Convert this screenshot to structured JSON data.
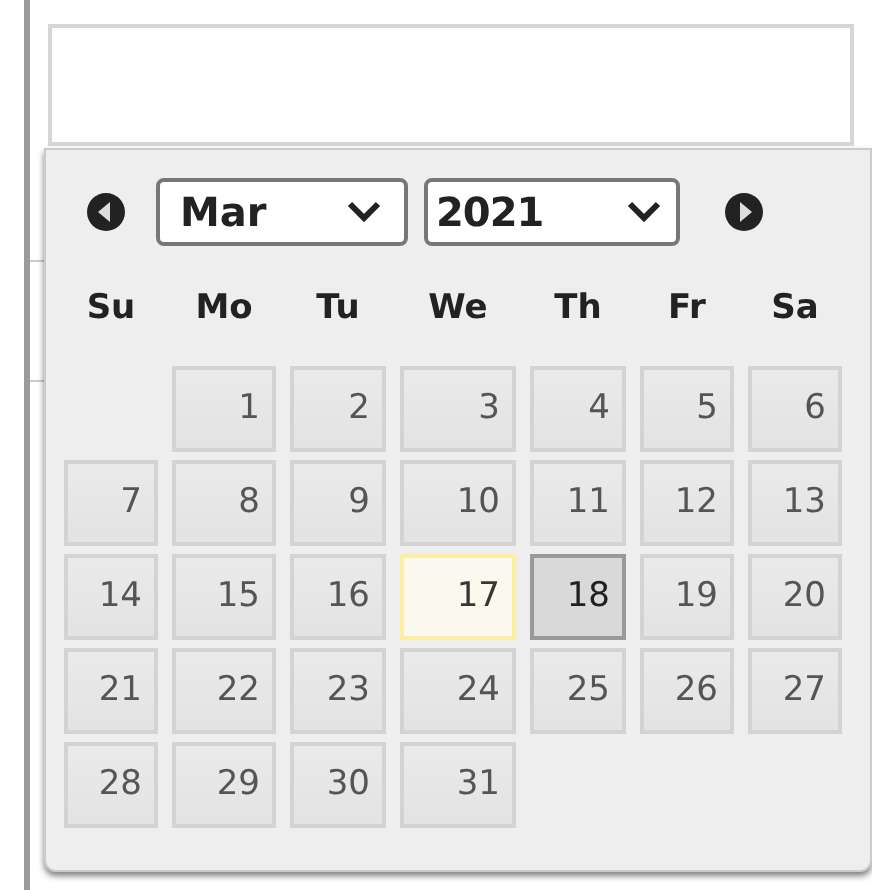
{
  "calendar": {
    "month": "Mar",
    "year": "2021",
    "weekdays": [
      "Su",
      "Mo",
      "Tu",
      "We",
      "Th",
      "Fr",
      "Sa"
    ],
    "weeks": [
      [
        {
          "day": "1",
          "today": false,
          "selected": false
        },
        {
          "day": "2",
          "today": false,
          "selected": false
        },
        {
          "day": "3",
          "today": false,
          "selected": false
        },
        {
          "day": "4",
          "today": false,
          "selected": false
        },
        {
          "day": "5",
          "today": false,
          "selected": false
        },
        {
          "day": "6",
          "today": false,
          "selected": false
        }
      ],
      [
        {
          "day": "7",
          "today": false,
          "selected": false
        },
        {
          "day": "8",
          "today": false,
          "selected": false
        },
        {
          "day": "9",
          "today": false,
          "selected": false
        },
        {
          "day": "10",
          "today": false,
          "selected": false
        },
        {
          "day": "11",
          "today": false,
          "selected": false
        },
        {
          "day": "12",
          "today": false,
          "selected": false
        },
        {
          "day": "13",
          "today": false,
          "selected": false
        }
      ],
      [
        {
          "day": "14",
          "today": false,
          "selected": false
        },
        {
          "day": "15",
          "today": false,
          "selected": false
        },
        {
          "day": "16",
          "today": false,
          "selected": false
        },
        {
          "day": "17",
          "today": true,
          "selected": false
        },
        {
          "day": "18",
          "today": false,
          "selected": true
        },
        {
          "day": "19",
          "today": false,
          "selected": false
        },
        {
          "day": "20",
          "today": false,
          "selected": false
        }
      ],
      [
        {
          "day": "21",
          "today": false,
          "selected": false
        },
        {
          "day": "22",
          "today": false,
          "selected": false
        },
        {
          "day": "23",
          "today": false,
          "selected": false
        },
        {
          "day": "24",
          "today": false,
          "selected": false
        },
        {
          "day": "25",
          "today": false,
          "selected": false
        },
        {
          "day": "26",
          "today": false,
          "selected": false
        },
        {
          "day": "27",
          "today": false,
          "selected": false
        }
      ],
      [
        {
          "day": "28",
          "today": false,
          "selected": false
        },
        {
          "day": "29",
          "today": false,
          "selected": false
        },
        {
          "day": "30",
          "today": false,
          "selected": false
        },
        {
          "day": "31",
          "today": false,
          "selected": false
        }
      ]
    ]
  }
}
